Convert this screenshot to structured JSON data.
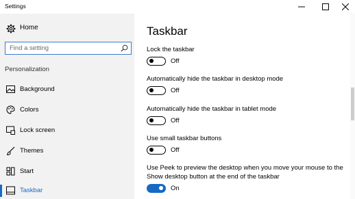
{
  "window": {
    "title": "Settings",
    "controls": [
      "minimize-icon",
      "maximize-icon",
      "close-icon"
    ]
  },
  "sidebar": {
    "home_label": "Home",
    "home_icon": "gear-icon",
    "search": {
      "placeholder": "Find a setting",
      "icon": "search-icon"
    },
    "section_label": "Personalization",
    "items": [
      {
        "label": "Background",
        "icon": "picture-icon"
      },
      {
        "label": "Colors",
        "icon": "palette-icon"
      },
      {
        "label": "Lock screen",
        "icon": "lock-screen-icon"
      },
      {
        "label": "Themes",
        "icon": "brush-icon"
      },
      {
        "label": "Start",
        "icon": "start-icon"
      },
      {
        "label": "Taskbar",
        "icon": "taskbar-icon",
        "active": true
      }
    ]
  },
  "main": {
    "title": "Taskbar",
    "settings": [
      {
        "label": "Lock the taskbar",
        "state": "Off",
        "on": false
      },
      {
        "label": "Automatically hide the taskbar in desktop mode",
        "state": "Off",
        "on": false
      },
      {
        "label": "Automatically hide the taskbar in tablet mode",
        "state": "Off",
        "on": false
      },
      {
        "label": "Use small taskbar buttons",
        "state": "Off",
        "on": false
      },
      {
        "label": "Use Peek to preview the desktop when you move your mouse to the Show desktop button at the end of the taskbar",
        "state": "On",
        "on": true
      }
    ]
  },
  "colors": {
    "accent": "#1769c4",
    "sidebar_bg": "#f2f2f2"
  }
}
